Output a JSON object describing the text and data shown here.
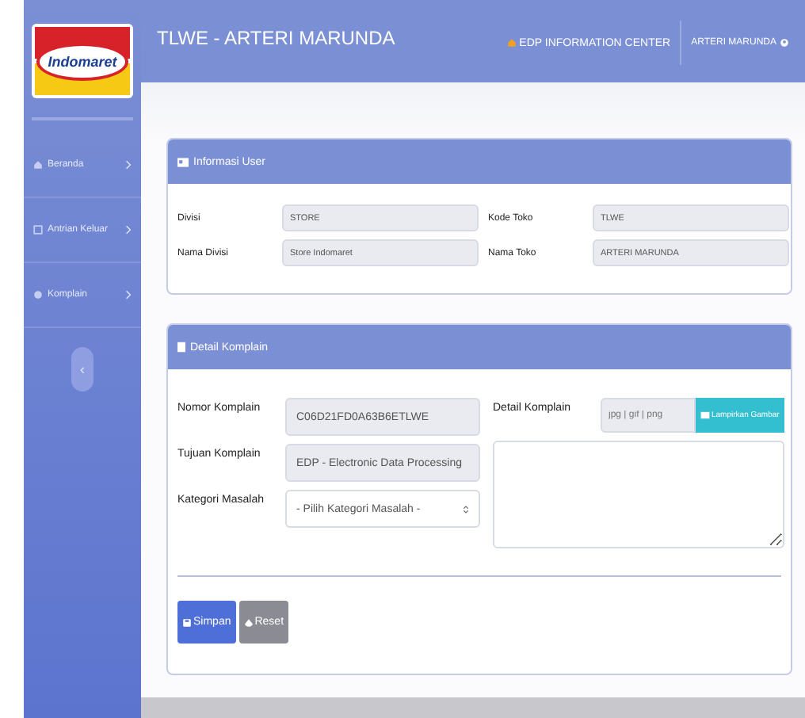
{
  "logo": {
    "text": "Indomaret"
  },
  "header": {
    "title": "TLWE - ARTERI MARUNDA",
    "links": [
      {
        "label": "EDP INFORMATION CENTER",
        "kind": "home"
      },
      {
        "label": "ARTERI MARUNDA",
        "kind": "user"
      }
    ]
  },
  "sidebar": {
    "items": [
      {
        "label": "Beranda",
        "kind": "home"
      },
      {
        "label": "Antrian Keluar",
        "kind": "queue"
      },
      {
        "label": "Komplain",
        "kind": "complaint"
      }
    ],
    "collapse": "‹"
  },
  "user_info": {
    "title": "Informasi User",
    "fields": [
      {
        "label": "Divisi",
        "value": "STORE"
      },
      {
        "label": "Kode Toko",
        "value": "TLWE"
      },
      {
        "label": "Nama Divisi",
        "value": "Store Indomaret"
      },
      {
        "label": "Nama Toko",
        "value": "ARTERI MARUNDA"
      }
    ]
  },
  "complaint": {
    "title": "Detail Komplain",
    "fields": [
      {
        "label": "Nomor Komplain",
        "kind": "readonly",
        "value": "C06D21FD0A63B6ETLWE"
      },
      {
        "label": "Tujuan Komplain",
        "kind": "readonly",
        "value": "EDP - Electronic Data Processing"
      },
      {
        "label": "Kategori Masalah",
        "kind": "select",
        "value": "- Pilih Kategori Masalah -"
      }
    ],
    "detail": {
      "label": "Detail Komplain",
      "placeholder": "jpg | gif | png",
      "attach_button": "Lampirkan Gambar"
    },
    "buttons": [
      {
        "label": "Simpan",
        "kind": "primary"
      },
      {
        "label": "Reset",
        "kind": "secondary"
      }
    ]
  }
}
